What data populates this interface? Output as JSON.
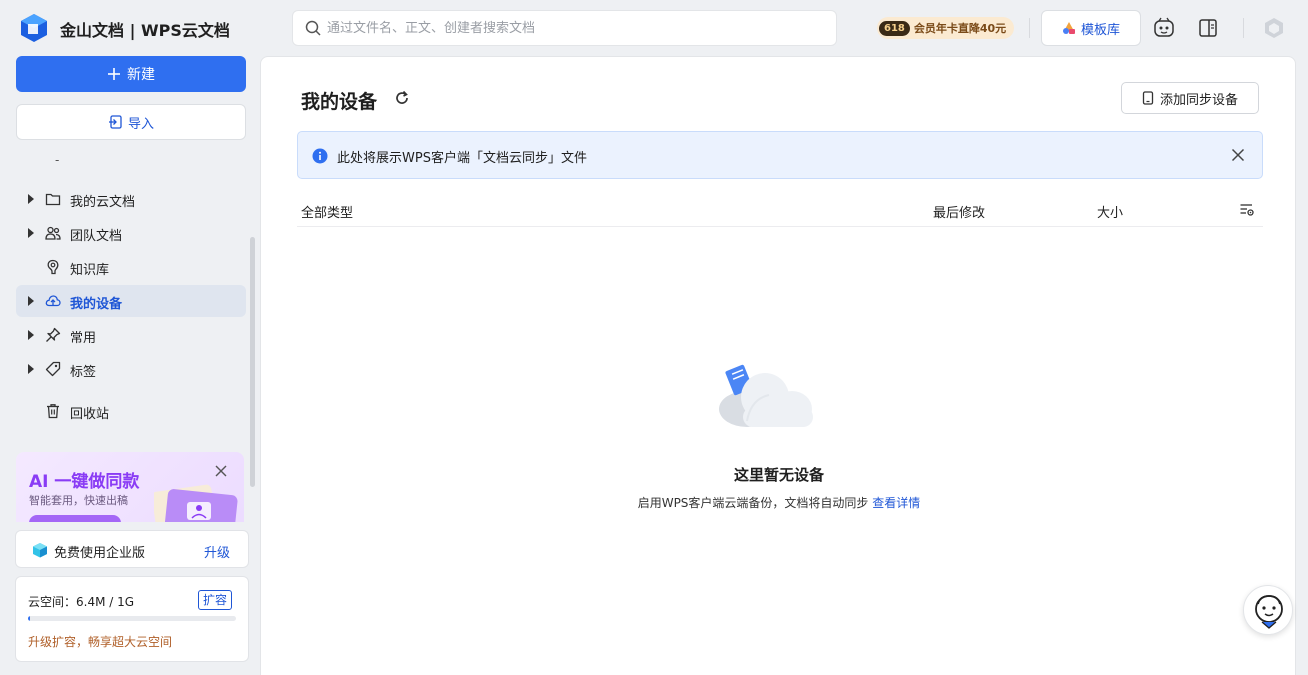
{
  "app": {
    "title": "金山文档 | WPS云文档"
  },
  "search": {
    "placeholder": "通过文件名、正文、创建者搜索文档"
  },
  "promo": {
    "badge": "618",
    "text": "会员年卡直降40元"
  },
  "toolbar": {
    "template_label": "模板库"
  },
  "sidebar": {
    "new_label": "新建",
    "import_label": "导入",
    "separator_text": "-",
    "items": [
      {
        "label": "我的云文档",
        "icon": "folder-icon",
        "expandable": true
      },
      {
        "label": "团队文档",
        "icon": "team-icon",
        "expandable": true
      },
      {
        "label": "知识库",
        "icon": "knowledge-icon",
        "expandable": false
      },
      {
        "label": "我的设备",
        "icon": "cloud-upload-icon",
        "expandable": true,
        "active": true
      },
      {
        "label": "常用",
        "icon": "pin-icon",
        "expandable": true
      },
      {
        "label": "标签",
        "icon": "tag-icon",
        "expandable": true
      },
      {
        "label": "回收站",
        "icon": "trash-icon",
        "expandable": false
      }
    ],
    "ai_card": {
      "title": "AI 一键做同款",
      "subtitle": "智能套用，快速出稿"
    },
    "enterprise": {
      "text": "免费使用企业版",
      "upgrade": "升级"
    },
    "space": {
      "label": "云空间：6.4M / 1G",
      "expand": "扩容",
      "tip": "升级扩容，畅享超大云空间",
      "used_fraction": 0.0064
    }
  },
  "main": {
    "title": "我的设备",
    "add_device_label": "添加同步设备",
    "info_text": "此处将展示WPS客户端「文档云同步」文件",
    "columns": {
      "type": "全部类型",
      "modified": "最后修改",
      "size": "大小"
    },
    "empty": {
      "title": "这里暂无设备",
      "desc": "启用WPS客户端云端备份，文档将自动同步",
      "link": "查看详情"
    }
  },
  "colors": {
    "accent": "#2f6ff0",
    "link": "#1f56d6",
    "info_bg": "#ebf2fe",
    "ai_purple": "#8a3cf5"
  }
}
